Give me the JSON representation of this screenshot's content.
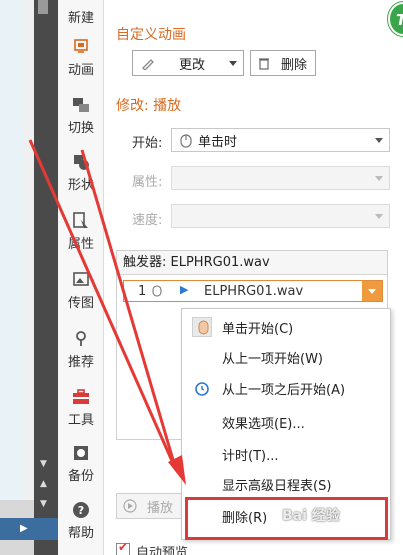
{
  "sidebar": {
    "items": [
      {
        "label": "新建",
        "icon": "new-icon"
      },
      {
        "label": "动画",
        "icon": "animation-icon"
      },
      {
        "label": "切换",
        "icon": "transition-icon"
      },
      {
        "label": "形状",
        "icon": "shape-icon"
      },
      {
        "label": "属性",
        "icon": "properties-icon"
      },
      {
        "label": "传图",
        "icon": "upload-image-icon"
      },
      {
        "label": "推荐",
        "icon": "recommend-icon"
      },
      {
        "label": "工具",
        "icon": "toolbox-icon"
      },
      {
        "label": "备份",
        "icon": "backup-icon"
      },
      {
        "label": "帮助",
        "icon": "help-icon"
      }
    ]
  },
  "panel": {
    "custom_anim_title": "自定义动画",
    "change_label": "更改",
    "delete_label": "删除",
    "modify_title": "修改: 播放",
    "start_label": "开始:",
    "start_value": "单击时",
    "property_label": "属性:",
    "speed_label": "速度:",
    "trigger_label": "触发器: ELPHRG01.wav",
    "list_item_index": "1",
    "list_item_name": "ELPHRG01.wav",
    "play_label": "播放",
    "autopreview_label": "自动预览"
  },
  "context_menu": {
    "items": [
      "单击开始(C)",
      "从上一项开始(W)",
      "从上一项之后开始(A)",
      "效果选项(E)...",
      "计时(T)...",
      "显示高级日程表(S)",
      "删除(R)"
    ]
  },
  "colors": {
    "accent_orange": "#d86a1f",
    "highlight_red": "#d93b3b",
    "arrow_red": "#e53935"
  },
  "watermark": "Bai 经验"
}
